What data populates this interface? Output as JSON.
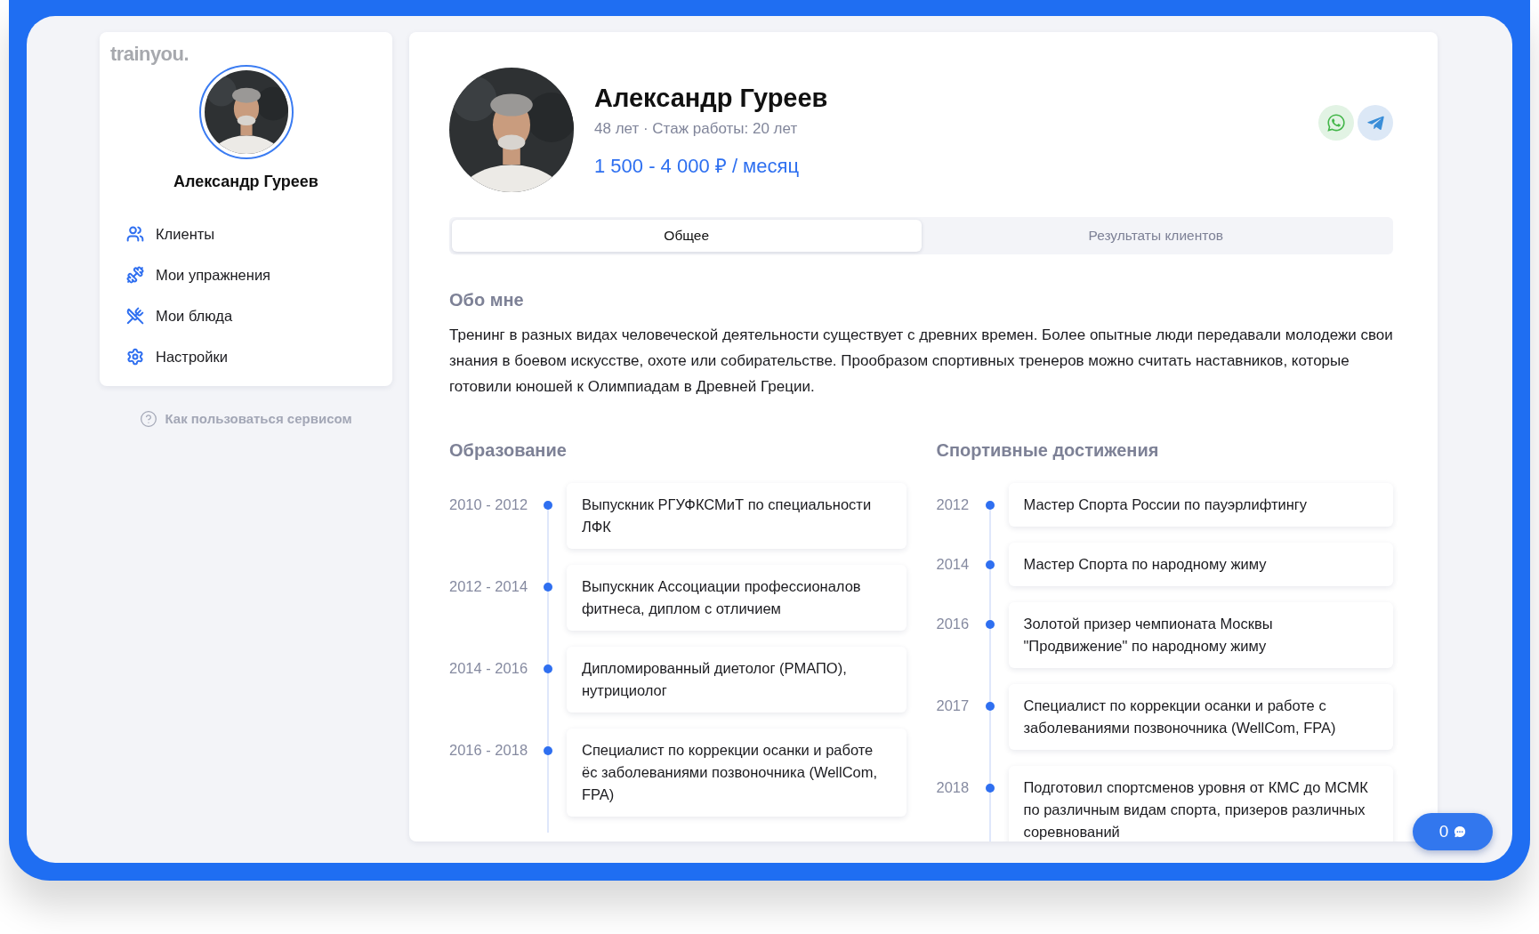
{
  "sidebar": {
    "logo": "trainyou.",
    "profile_name": "Александр Гуреев",
    "nav": [
      {
        "kind": "users",
        "label": "Клиенты"
      },
      {
        "kind": "dumbbell",
        "label": "Мои упражнения"
      },
      {
        "kind": "utensils",
        "label": "Мои блюда"
      },
      {
        "kind": "settings",
        "label": "Настройки"
      }
    ],
    "help_link": "Как пользоваться сервисом"
  },
  "profile": {
    "name": "Александр Гуреев",
    "meta": "48 лет · Стаж работы: 20 лет",
    "price": "1 500 - 4 000 ₽ / месяц",
    "contacts": [
      {
        "kind": "whatsapp"
      },
      {
        "kind": "telegram"
      }
    ]
  },
  "tabs": [
    {
      "label": "Общее",
      "selected": true
    },
    {
      "label": "Результаты клиентов",
      "selected": false
    }
  ],
  "about": {
    "title": "Обо мне",
    "text": "Тренинг в разных видах человеческой деятельности существует с древних времен. Более опытные люди передавали молодежи свои знания в боевом искусстве, охоте или собирательстве. Прообразом спортивных тренеров можно считать наставников, которые готовили юношей к Олимпиадам в Древней Греции."
  },
  "education": {
    "title": "Образование",
    "items": [
      {
        "period": "2010 - 2012",
        "text": "Выпускник РГУФКСМиТ по специальности ЛФК"
      },
      {
        "period": "2012 - 2014",
        "text": "Выпускник Ассоциации профессионалов фитнеса, диплом с отличием"
      },
      {
        "period": "2014 - 2016",
        "text": "Дипломированный диетолог (РМАПО), нутрициолог"
      },
      {
        "period": "2016 - 2018",
        "text": "Специалист по коррекции осанки и работе ёс заболеваниями позвоночника (WellCom, FPA)"
      }
    ]
  },
  "achievements": {
    "title": "Спортивные достижения",
    "items": [
      {
        "period": "2012",
        "text": "Мастер Спорта России по пауэрлифтингу"
      },
      {
        "period": "2014",
        "text": "Мастер Спорта по народному жиму"
      },
      {
        "period": "2016",
        "text": "Золотой призер чемпионата Москвы \"Продвижение\" по народному жиму"
      },
      {
        "period": "2017",
        "text": "Специалист по коррекции осанки и работе с заболеваниями позвоночника (WellCom, FPA)"
      },
      {
        "period": "2018",
        "text": "Подготовил спортсменов уровня от КМС до МСМК по различным видам спорта, призеров различных соревнований"
      }
    ]
  },
  "chat_button": {
    "count": "0"
  }
}
